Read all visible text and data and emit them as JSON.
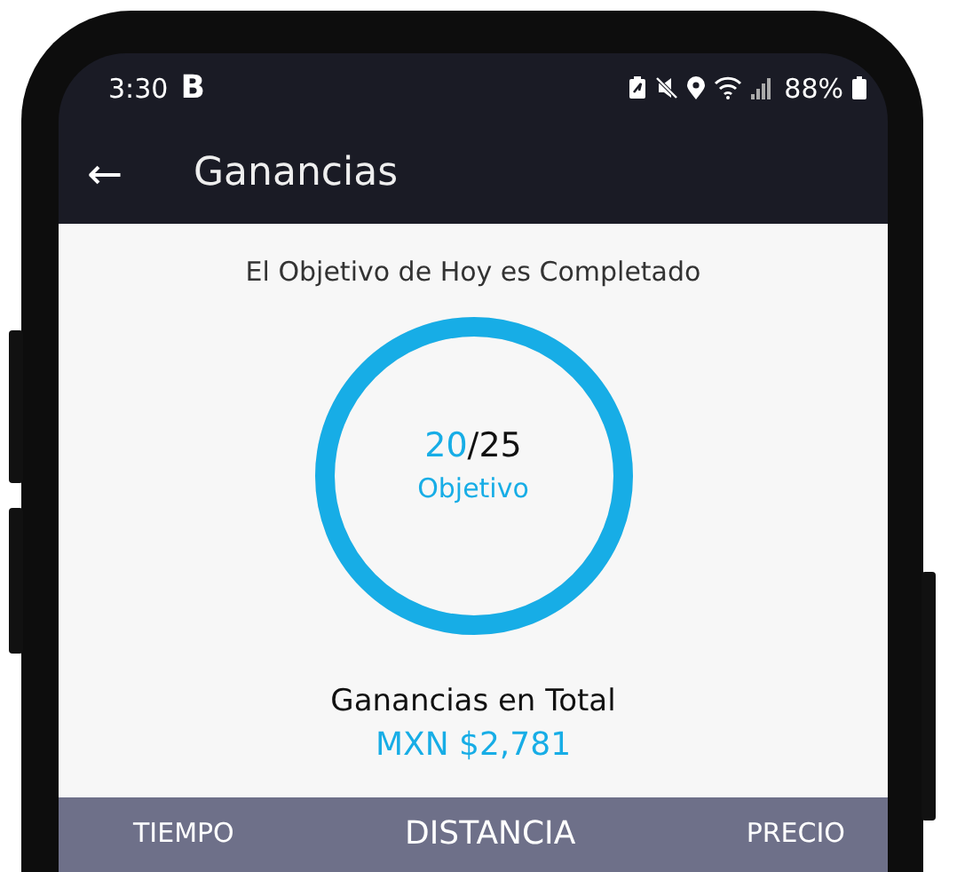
{
  "status_bar": {
    "time": "3:30",
    "app_badge": "B",
    "battery": "88%"
  },
  "app_bar": {
    "back": "←",
    "title": "Ganancias"
  },
  "goal": {
    "heading": "El Objetivo de Hoy es Completado",
    "current": "20",
    "rest": "/25",
    "label": "Objetivo"
  },
  "earnings": {
    "label": "Ganancias en Total",
    "amount": "MXN $2,781"
  },
  "tabs": [
    {
      "label": "TIEMPO",
      "selected": false
    },
    {
      "label": "DISTANCIA",
      "selected": true
    },
    {
      "label": "PRECIO",
      "selected": false
    }
  ]
}
